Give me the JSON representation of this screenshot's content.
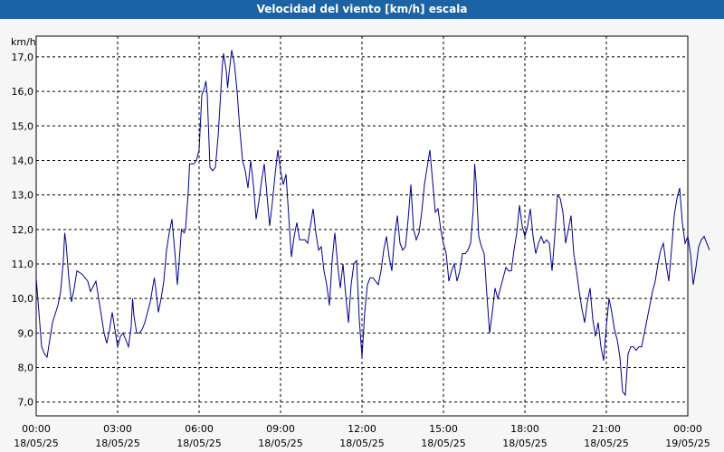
{
  "chart_data": {
    "type": "line",
    "title": "Velocidad del viento [km/h] escala",
    "ylabel": "km/h",
    "ylim": [
      6.6,
      17.6
    ],
    "xlim_hours": [
      0,
      24
    ],
    "grid": true,
    "y_ticks": [
      "7,0",
      "8,0",
      "9,0",
      "10,0",
      "11,0",
      "12,0",
      "13,0",
      "14,0",
      "15,0",
      "16,0",
      "17,0"
    ],
    "y_tick_values": [
      7,
      8,
      9,
      10,
      11,
      12,
      13,
      14,
      15,
      16,
      17
    ],
    "x_ticks": [
      {
        "time": "00:00",
        "date": "18/05/25"
      },
      {
        "time": "03:00",
        "date": "18/05/25"
      },
      {
        "time": "06:00",
        "date": "18/05/25"
      },
      {
        "time": "09:00",
        "date": "18/05/25"
      },
      {
        "time": "12:00",
        "date": "18/05/25"
      },
      {
        "time": "15:00",
        "date": "18/05/25"
      },
      {
        "time": "18:00",
        "date": "18/05/25"
      },
      {
        "time": "21:00",
        "date": "18/05/25"
      },
      {
        "time": "00:00",
        "date": "19/05/25"
      }
    ],
    "line_color": "#00008b",
    "series": [
      {
        "points": [
          [
            0.0,
            10.6
          ],
          [
            0.1,
            9.6
          ],
          [
            0.2,
            8.6
          ],
          [
            0.3,
            8.4
          ],
          [
            0.4,
            8.3
          ],
          [
            0.5,
            8.8
          ],
          [
            0.6,
            9.3
          ],
          [
            0.8,
            9.8
          ],
          [
            0.9,
            10.2
          ],
          [
            1.0,
            11.1
          ],
          [
            1.05,
            11.9
          ],
          [
            1.1,
            11.6
          ],
          [
            1.2,
            10.6
          ],
          [
            1.3,
            9.9
          ],
          [
            1.4,
            10.3
          ],
          [
            1.5,
            10.8
          ],
          [
            1.7,
            10.7
          ],
          [
            1.9,
            10.5
          ],
          [
            2.0,
            10.2
          ],
          [
            2.2,
            10.5
          ],
          [
            2.3,
            10.0
          ],
          [
            2.4,
            9.5
          ],
          [
            2.5,
            9.0
          ],
          [
            2.6,
            8.7
          ],
          [
            2.7,
            9.1
          ],
          [
            2.8,
            9.6
          ],
          [
            2.9,
            9.1
          ],
          [
            3.0,
            8.6
          ],
          [
            3.1,
            8.9
          ],
          [
            3.2,
            9.0
          ],
          [
            3.3,
            8.8
          ],
          [
            3.4,
            8.6
          ],
          [
            3.5,
            9.2
          ],
          [
            3.55,
            10.0
          ],
          [
            3.6,
            9.5
          ],
          [
            3.7,
            9.0
          ],
          [
            3.8,
            9.0
          ],
          [
            3.9,
            9.1
          ],
          [
            4.0,
            9.3
          ],
          [
            4.2,
            9.9
          ],
          [
            4.35,
            10.6
          ],
          [
            4.4,
            10.3
          ],
          [
            4.5,
            9.6
          ],
          [
            4.6,
            10.0
          ],
          [
            4.7,
            10.5
          ],
          [
            4.8,
            11.4
          ],
          [
            4.9,
            11.9
          ],
          [
            5.0,
            12.3
          ],
          [
            5.1,
            11.4
          ],
          [
            5.2,
            10.4
          ],
          [
            5.25,
            10.9
          ],
          [
            5.35,
            12.0
          ],
          [
            5.45,
            11.9
          ],
          [
            5.5,
            12.0
          ],
          [
            5.6,
            13.1
          ],
          [
            5.65,
            13.9
          ],
          [
            5.7,
            13.9
          ],
          [
            5.8,
            13.9
          ],
          [
            5.9,
            14.0
          ],
          [
            6.0,
            14.3
          ],
          [
            6.05,
            15.1
          ],
          [
            6.1,
            15.9
          ],
          [
            6.2,
            16.1
          ],
          [
            6.25,
            16.3
          ],
          [
            6.3,
            15.9
          ],
          [
            6.4,
            13.8
          ],
          [
            6.5,
            13.7
          ],
          [
            6.6,
            13.8
          ],
          [
            6.7,
            14.7
          ],
          [
            6.8,
            16.0
          ],
          [
            6.85,
            16.7
          ],
          [
            6.9,
            17.1
          ],
          [
            7.0,
            16.6
          ],
          [
            7.05,
            16.1
          ],
          [
            7.1,
            16.5
          ],
          [
            7.2,
            17.2
          ],
          [
            7.3,
            16.8
          ],
          [
            7.4,
            16.0
          ],
          [
            7.5,
            14.9
          ],
          [
            7.6,
            14.0
          ],
          [
            7.7,
            13.7
          ],
          [
            7.8,
            13.2
          ],
          [
            7.9,
            14.0
          ],
          [
            8.0,
            13.3
          ],
          [
            8.1,
            12.3
          ],
          [
            8.2,
            12.8
          ],
          [
            8.3,
            13.4
          ],
          [
            8.4,
            13.9
          ],
          [
            8.5,
            13.0
          ],
          [
            8.6,
            12.1
          ],
          [
            8.7,
            12.8
          ],
          [
            8.8,
            13.6
          ],
          [
            8.9,
            14.3
          ],
          [
            9.0,
            13.7
          ],
          [
            9.1,
            13.3
          ],
          [
            9.2,
            13.6
          ],
          [
            9.3,
            12.4
          ],
          [
            9.4,
            11.2
          ],
          [
            9.5,
            11.8
          ],
          [
            9.6,
            12.2
          ],
          [
            9.7,
            11.7
          ],
          [
            9.8,
            11.7
          ],
          [
            9.9,
            11.7
          ],
          [
            10.0,
            11.6
          ],
          [
            10.1,
            12.1
          ],
          [
            10.2,
            12.6
          ],
          [
            10.3,
            11.9
          ],
          [
            10.4,
            11.4
          ],
          [
            10.5,
            11.5
          ],
          [
            10.6,
            10.8
          ],
          [
            10.7,
            10.4
          ],
          [
            10.8,
            9.8
          ],
          [
            10.9,
            11.1
          ],
          [
            11.0,
            11.9
          ],
          [
            11.1,
            11.0
          ],
          [
            11.2,
            10.3
          ],
          [
            11.3,
            11.0
          ],
          [
            11.4,
            10.1
          ],
          [
            11.5,
            9.3
          ],
          [
            11.6,
            10.4
          ],
          [
            11.7,
            11.0
          ],
          [
            11.8,
            11.1
          ],
          [
            11.9,
            9.4
          ],
          [
            12.0,
            8.3
          ],
          [
            12.1,
            9.6
          ],
          [
            12.2,
            10.4
          ],
          [
            12.3,
            10.6
          ],
          [
            12.4,
            10.6
          ],
          [
            12.5,
            10.5
          ],
          [
            12.6,
            10.4
          ],
          [
            12.7,
            10.8
          ],
          [
            12.8,
            11.4
          ],
          [
            12.9,
            11.8
          ],
          [
            13.0,
            11.2
          ],
          [
            13.1,
            10.8
          ],
          [
            13.2,
            11.8
          ],
          [
            13.3,
            12.4
          ],
          [
            13.4,
            11.6
          ],
          [
            13.5,
            11.4
          ],
          [
            13.6,
            11.5
          ],
          [
            13.7,
            12.3
          ],
          [
            13.8,
            13.3
          ],
          [
            13.9,
            12.0
          ],
          [
            14.0,
            11.7
          ],
          [
            14.1,
            11.9
          ],
          [
            14.2,
            12.5
          ],
          [
            14.3,
            13.3
          ],
          [
            14.4,
            13.8
          ],
          [
            14.5,
            14.3
          ],
          [
            14.6,
            13.4
          ],
          [
            14.7,
            12.5
          ],
          [
            14.8,
            12.6
          ],
          [
            14.9,
            12.0
          ],
          [
            15.0,
            11.6
          ],
          [
            15.1,
            11.3
          ],
          [
            15.2,
            10.5
          ],
          [
            15.3,
            10.8
          ],
          [
            15.4,
            11.0
          ],
          [
            15.5,
            10.5
          ],
          [
            15.6,
            10.8
          ],
          [
            15.7,
            11.3
          ],
          [
            15.8,
            11.3
          ],
          [
            15.9,
            11.4
          ],
          [
            16.0,
            11.6
          ],
          [
            16.1,
            12.6
          ],
          [
            16.15,
            13.9
          ],
          [
            16.2,
            13.4
          ],
          [
            16.3,
            11.8
          ],
          [
            16.4,
            11.5
          ],
          [
            16.5,
            11.3
          ],
          [
            16.6,
            10.1
          ],
          [
            16.7,
            9.0
          ],
          [
            16.8,
            9.6
          ],
          [
            16.9,
            10.3
          ],
          [
            17.0,
            10.0
          ],
          [
            17.1,
            10.3
          ],
          [
            17.2,
            10.6
          ],
          [
            17.3,
            10.9
          ],
          [
            17.4,
            10.8
          ],
          [
            17.5,
            10.8
          ],
          [
            17.6,
            11.4
          ],
          [
            17.7,
            11.9
          ],
          [
            17.8,
            12.7
          ],
          [
            17.9,
            12.1
          ],
          [
            18.0,
            11.8
          ],
          [
            18.1,
            12.1
          ],
          [
            18.2,
            12.6
          ],
          [
            18.3,
            11.8
          ],
          [
            18.4,
            11.3
          ],
          [
            18.5,
            11.6
          ],
          [
            18.6,
            11.8
          ],
          [
            18.7,
            11.6
          ],
          [
            18.8,
            11.7
          ],
          [
            18.9,
            11.6
          ],
          [
            19.0,
            10.8
          ],
          [
            19.1,
            11.8
          ],
          [
            19.2,
            13.0
          ],
          [
            19.3,
            12.9
          ],
          [
            19.4,
            12.5
          ],
          [
            19.5,
            11.6
          ],
          [
            19.6,
            12.0
          ],
          [
            19.7,
            12.4
          ],
          [
            19.8,
            11.3
          ],
          [
            19.9,
            10.8
          ],
          [
            20.0,
            10.2
          ],
          [
            20.1,
            9.7
          ],
          [
            20.2,
            9.3
          ],
          [
            20.3,
            9.9
          ],
          [
            20.4,
            10.3
          ],
          [
            20.5,
            9.4
          ],
          [
            20.6,
            8.9
          ],
          [
            20.7,
            9.3
          ],
          [
            20.8,
            8.6
          ],
          [
            20.9,
            8.2
          ],
          [
            21.0,
            9.2
          ],
          [
            21.1,
            10.0
          ],
          [
            21.2,
            9.6
          ],
          [
            21.3,
            9.1
          ],
          [
            21.4,
            8.8
          ],
          [
            21.5,
            8.3
          ],
          [
            21.6,
            7.3
          ],
          [
            21.7,
            7.2
          ],
          [
            21.8,
            8.4
          ],
          [
            21.9,
            8.6
          ],
          [
            22.0,
            8.6
          ],
          [
            22.1,
            8.5
          ],
          [
            22.2,
            8.6
          ],
          [
            22.3,
            8.6
          ],
          [
            22.4,
            9.0
          ],
          [
            22.5,
            9.4
          ],
          [
            22.6,
            9.8
          ],
          [
            22.7,
            10.2
          ],
          [
            22.8,
            10.5
          ],
          [
            22.9,
            11.0
          ],
          [
            23.0,
            11.4
          ],
          [
            23.1,
            11.6
          ],
          [
            23.2,
            11.0
          ],
          [
            23.3,
            10.5
          ],
          [
            23.4,
            11.4
          ],
          [
            23.5,
            12.4
          ],
          [
            23.6,
            12.9
          ],
          [
            23.7,
            13.2
          ],
          [
            23.8,
            12.2
          ],
          [
            23.9,
            11.6
          ],
          [
            24.0,
            11.8
          ],
          [
            24.1,
            11.3
          ],
          [
            24.2,
            10.4
          ],
          [
            24.3,
            10.9
          ],
          [
            24.4,
            11.5
          ],
          [
            24.5,
            11.7
          ],
          [
            24.6,
            11.8
          ],
          [
            24.7,
            11.6
          ],
          [
            24.8,
            11.4
          ]
        ]
      }
    ]
  }
}
